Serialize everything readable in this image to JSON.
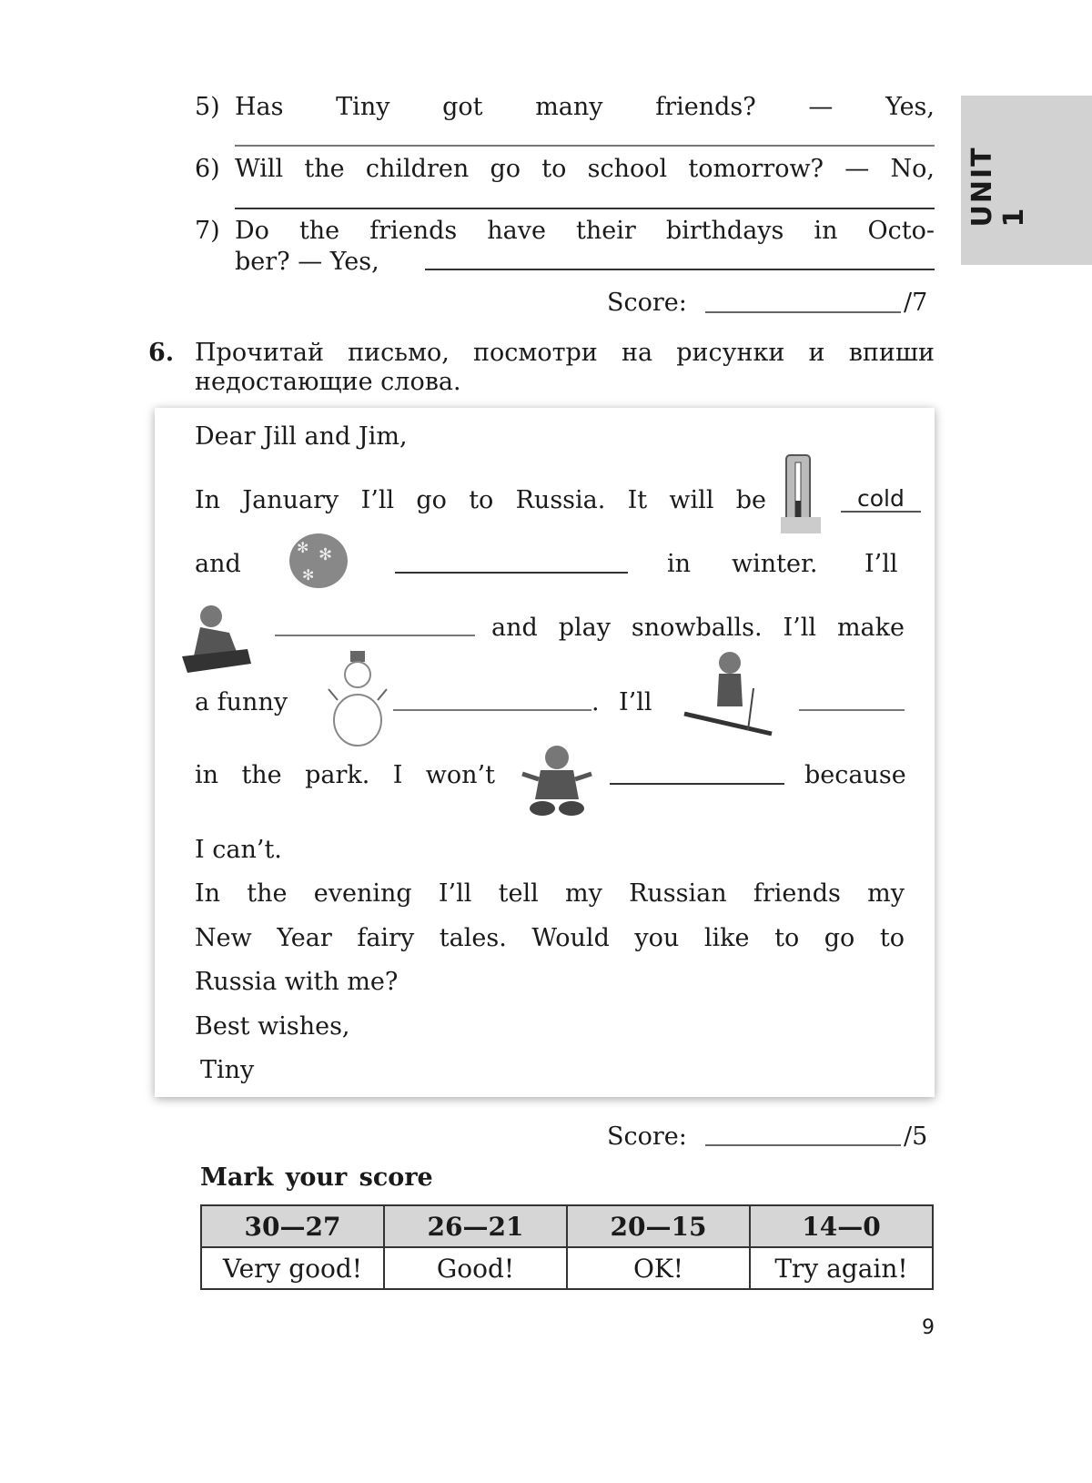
{
  "unit_tab": "UNIT 1",
  "questions": [
    {
      "number": "5)",
      "words": [
        "Has",
        "Tiny",
        "got",
        "many",
        "friends?",
        "—",
        "Yes,"
      ]
    },
    {
      "number": "6)",
      "text": "Will the children go to school tomorrow? — No,"
    },
    {
      "number": "7)",
      "line1": "Do the friends have their birthdays in Octo-",
      "line2": "ber? — Yes,"
    }
  ],
  "score1": {
    "label": "Score:",
    "max": "/7"
  },
  "task6": {
    "number": "6.",
    "line1": "Прочитай письмо, посмотри на рисунки и впиши",
    "line2": "недостающие слова."
  },
  "letter": {
    "greeting": "Dear Jill and Jim,",
    "l1": "In January I’ll go to Russia. It will be",
    "answer_cold": "cold",
    "l2a": "and",
    "l2b": "in",
    "l2c": "winter.",
    "l2d": "I’ll",
    "l3": "and play snowballs. I’ll make",
    "l4a": "a funny",
    "l4b": ".",
    "l4c": "I’ll",
    "l5a": "in the park. I won’t",
    "l5b": "because",
    "l6": "I can’t.",
    "l7": "In the evening I’ll tell my Russian friends my",
    "l8": "New Year fairy tales. Would you like to go to",
    "l9": "Russia with me?",
    "closing": "Best wishes,",
    "signature": "Tiny",
    "pictures": [
      "thermometer-icon",
      "snowflakes-icon",
      "sledging-child-icon",
      "snowman-icon",
      "skiing-child-icon",
      "sitting-child-icon"
    ]
  },
  "score2": {
    "label": "Score:",
    "max": "/5"
  },
  "mark_title": "Mark your score",
  "score_table": {
    "ranges": [
      "30—27",
      "26—21",
      "20—15",
      "14—0"
    ],
    "grades": [
      "Very good!",
      "Good!",
      "OK!",
      "Try again!"
    ]
  },
  "page_number": "9"
}
